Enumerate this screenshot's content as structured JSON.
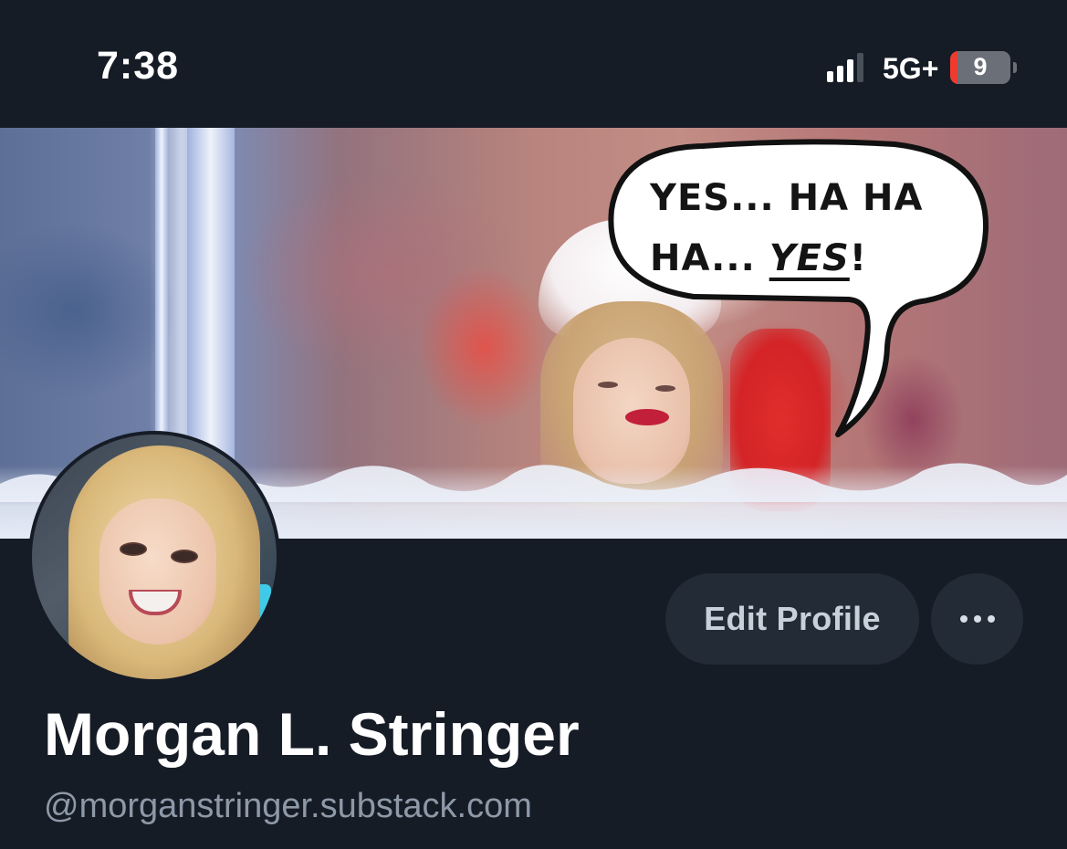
{
  "status_bar": {
    "time": "7:38",
    "network": "5G+",
    "battery_level": "9",
    "battery_fraction": 0.09,
    "signal_bars_active": 3,
    "signal_bars_total": 4
  },
  "banner": {
    "speech_line1": "YES... HA HA",
    "speech_line2_prefix": "HA... ",
    "speech_line2_emphasis": "YES",
    "speech_line2_suffix": "!"
  },
  "profile": {
    "display_name": "Morgan L. Stringer",
    "handle": "@morganstringer.substack.com",
    "edit_label": "Edit Profile",
    "more_icon": "ellipsis-icon"
  },
  "colors": {
    "background": "#161c26",
    "button_bg": "#222b36",
    "handle_text": "#8e99a8",
    "battery_low": "#ef3b2f"
  }
}
